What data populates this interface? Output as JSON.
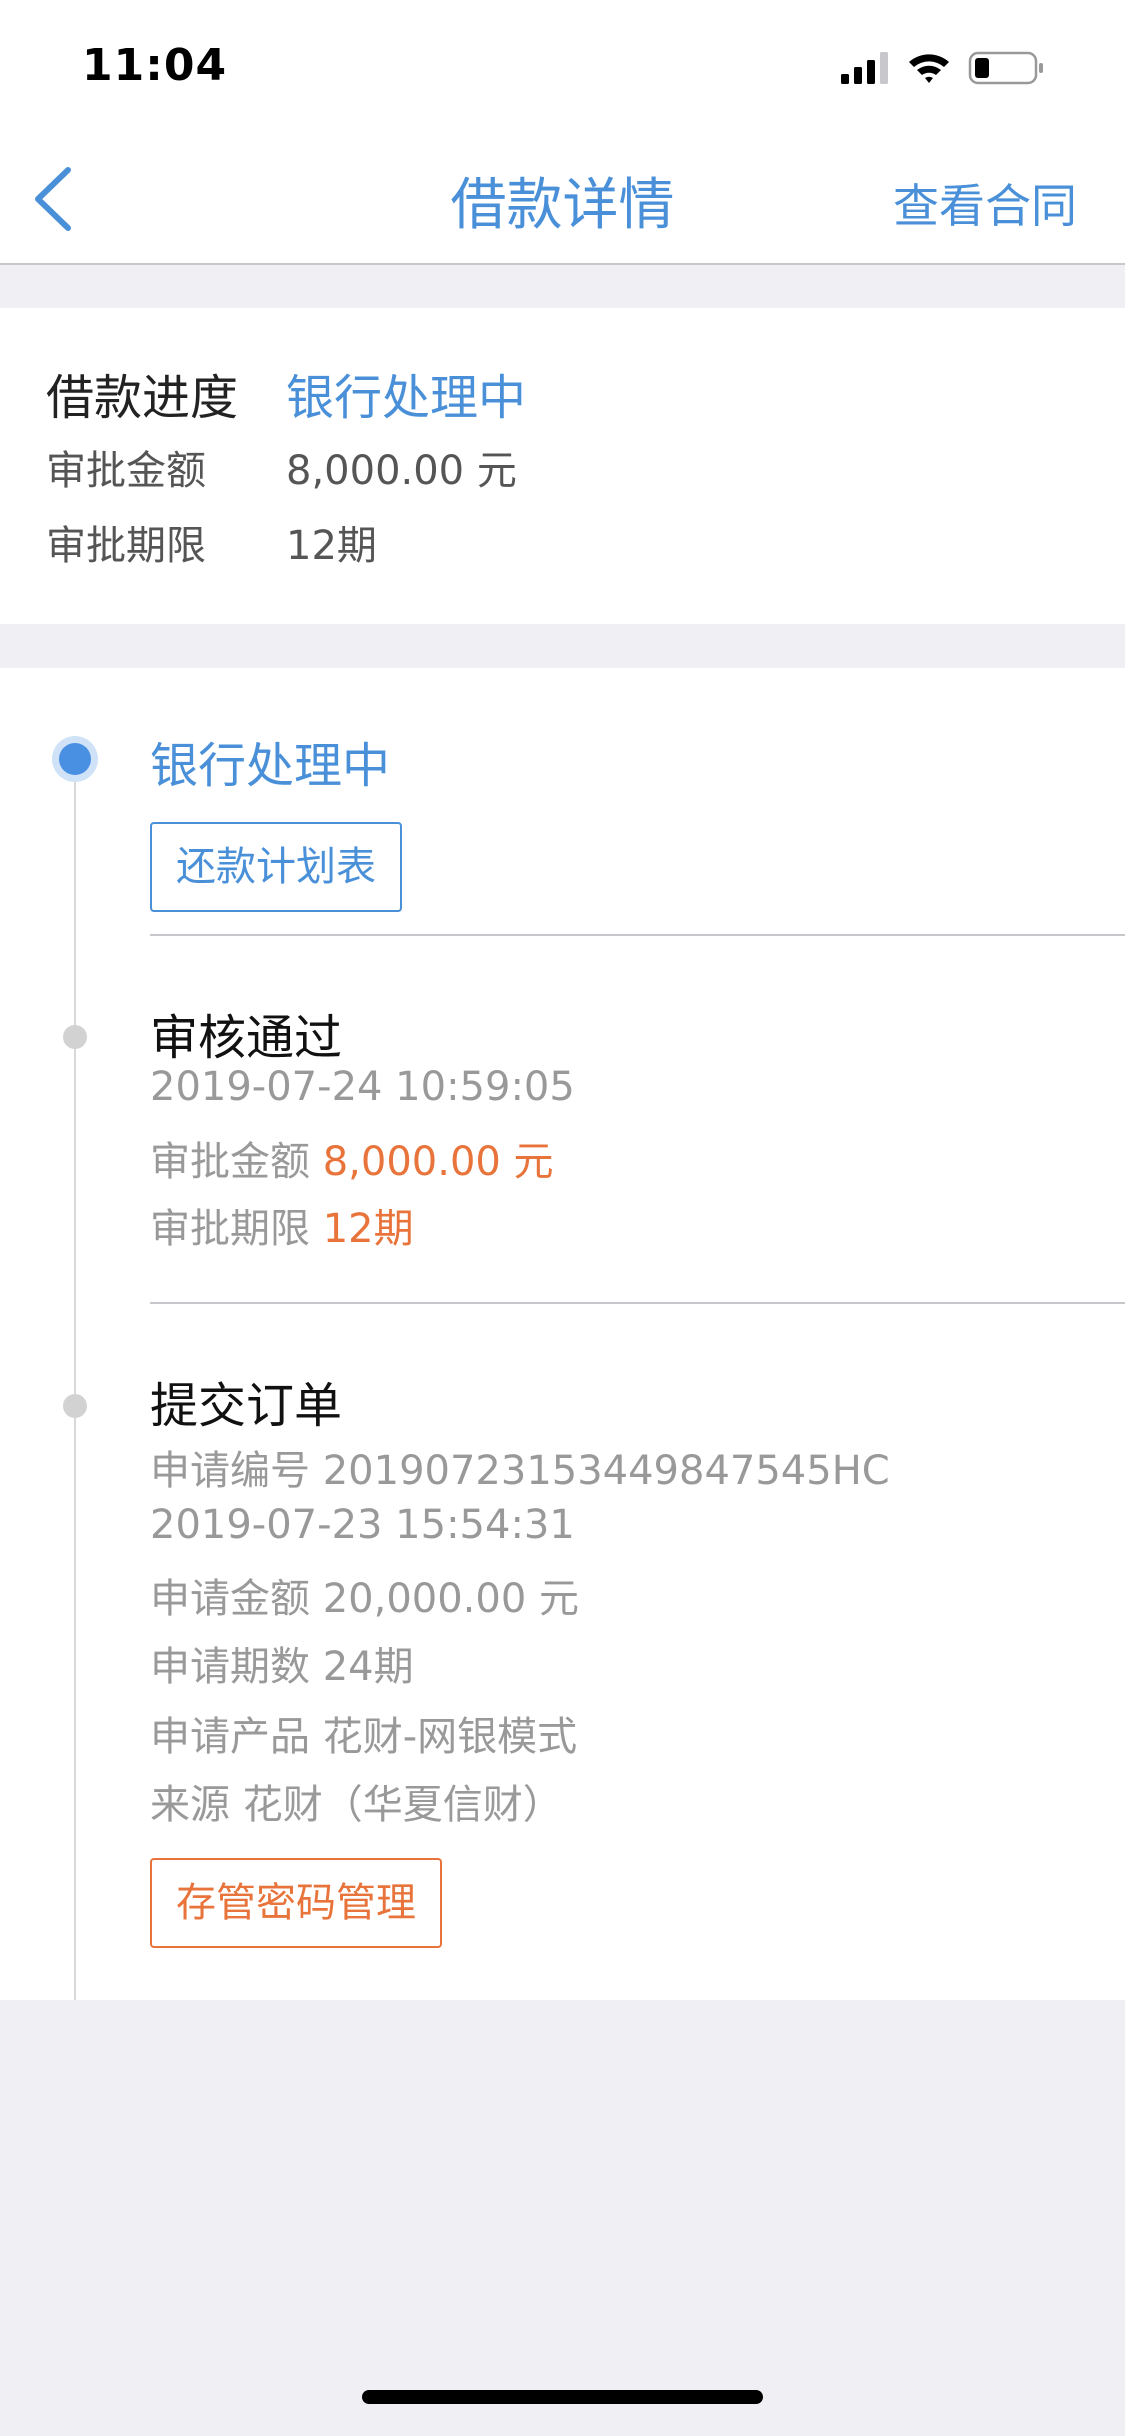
{
  "status_bar": {
    "time": "11:04",
    "icons": [
      "cellular-signal-icon",
      "wifi-icon",
      "battery-icon"
    ]
  },
  "nav": {
    "back_icon": "chevron-left-icon",
    "title": "借款详情",
    "right_action": "查看合同"
  },
  "summary": {
    "progress_label": "借款进度",
    "progress_value": "银行处理中",
    "amount_label": "审批金额",
    "amount_value": "8,000.00 元",
    "term_label": "审批期限",
    "term_value": "12期"
  },
  "timeline": {
    "step1": {
      "title": "银行处理中",
      "button_label": "还款计划表"
    },
    "step2": {
      "title": "审核通过",
      "datetime": "2019-07-24 10:59:05",
      "amount_label": "审批金额",
      "amount_value": "8,000.00 元",
      "term_label": "审批期限",
      "term_value": "12期"
    },
    "step3": {
      "title": "提交订单",
      "app_no_label": "申请编号",
      "app_no_value": "20190723153449847545HC",
      "datetime": "2019-07-23 15:54:31",
      "amount_label": "申请金额",
      "amount_value": "20,000.00 元",
      "periods_label": "申请期数",
      "periods_value": "24期",
      "product_label": "申请产品",
      "product_value": "花财-网银模式",
      "source_label": "来源",
      "source_value": "花财（华夏信财）",
      "button_label": "存管密码管理"
    }
  },
  "colors": {
    "accent_blue": "#4a90d9",
    "accent_orange": "#e8743b",
    "background": "#efeff4"
  }
}
